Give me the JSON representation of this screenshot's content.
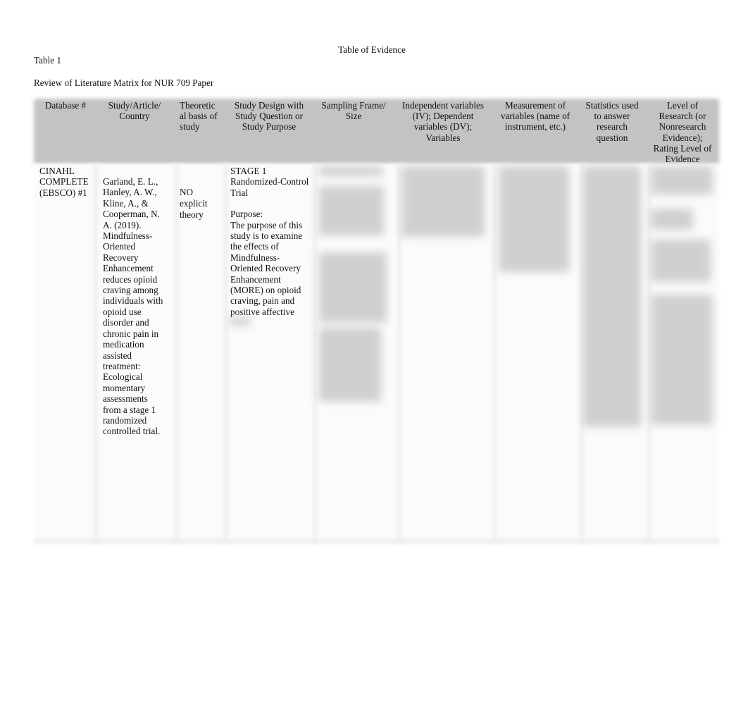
{
  "document": {
    "title": "Table of Evidence",
    "table_label": "Table 1",
    "table_caption": "Review of Literature Matrix for NUR 709 Paper"
  },
  "table": {
    "headers": [
      "Database #",
      "Study/Article/ Country",
      "Theoretic al basis of study",
      "Study Design with Study Question or Study Purpose",
      "Sampling Frame/ Size",
      "Independent variables (IV); Dependent variables (DV); Variables",
      "Measurement of variables (name of instrument, etc.)",
      "Statistics used to answer research question",
      "Level of Research (or Nonresearch Evidence); Rating Level of Evidence"
    ],
    "rows": [
      {
        "database": "CINAHL COMPLETE (EBSCO) #1",
        "study": "Garland, E. L., Hanley, A. W., Kline, A., & Cooperman, N. A. (2019). Mindfulness-Oriented Recovery Enhancement reduces opioid craving among individuals with opioid use disorder and chronic pain in medication assisted treatment: Ecological momentary assessments from a stage 1 randomized controlled trial.",
        "theory": "NO explicit theory",
        "design": "STAGE 1 Randomized-Control Trial",
        "purpose_label": "Purpose:",
        "purpose": "The purpose of this study is to examine the effects of Mindfulness-Oriented Recovery Enhancement (MORE) on opioid craving, pain and positive affective",
        "sampling": "",
        "variables": "",
        "measurement": "",
        "statistics": "",
        "level": ""
      }
    ]
  }
}
